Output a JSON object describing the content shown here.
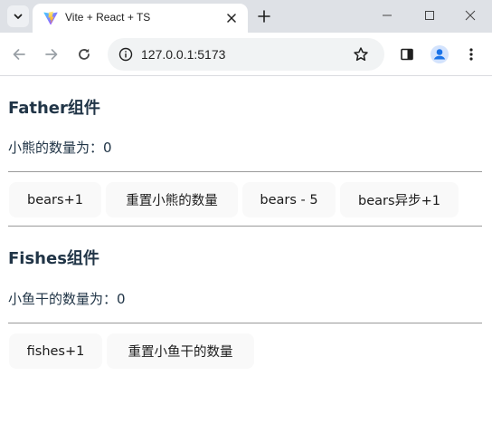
{
  "browser": {
    "tab_title": "Vite + React + TS",
    "url": "127.0.0.1:5173"
  },
  "father": {
    "title": "Father组件",
    "count_text": "小熊的数量为：0",
    "buttons": [
      "bears+1",
      "重置小熊的数量",
      "bears - 5",
      "bears异步+1"
    ]
  },
  "fishes": {
    "title": "Fishes组件",
    "count_text": "小鱼干的数量为：0",
    "buttons": [
      "fishes+1",
      "重置小鱼干的数量"
    ]
  },
  "colors": {
    "text": "#213547",
    "button_bg": "#f9f9f9",
    "tabstrip_bg": "#dee1e6",
    "omnibox_bg": "#f1f3f4",
    "profile_blue": "#1a73e8"
  }
}
